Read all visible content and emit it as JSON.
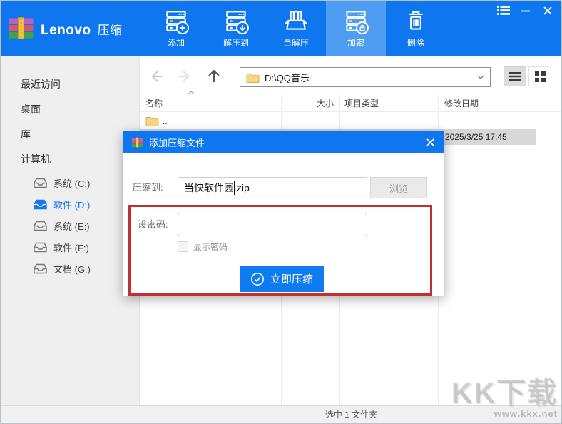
{
  "brand": {
    "name": "Lenovo",
    "app": "压缩"
  },
  "topbar": {
    "toolbar": [
      {
        "label": "添加"
      },
      {
        "label": "解压到"
      },
      {
        "label": "自解压"
      },
      {
        "label": "加密"
      },
      {
        "label": "删除"
      }
    ]
  },
  "sidebar": {
    "items": [
      {
        "label": "最近访问"
      },
      {
        "label": "桌面"
      },
      {
        "label": "库"
      },
      {
        "label": "计算机"
      }
    ],
    "drives": [
      {
        "label": "系统 (C:)"
      },
      {
        "label": "软件 (D:)"
      },
      {
        "label": "系统 (E:)"
      },
      {
        "label": "软件 (F:)"
      },
      {
        "label": "文档 (G:)"
      }
    ]
  },
  "nav": {
    "address": "D:\\QQ音乐"
  },
  "list": {
    "columns": [
      {
        "label": "名称"
      },
      {
        "label": "大小"
      },
      {
        "label": "项目类型"
      },
      {
        "label": "修改日期"
      }
    ],
    "parent_row": "..",
    "selected_row_date": "2025/3/25 17:45"
  },
  "statusbar": {
    "text": "选中 1 文件夹"
  },
  "dialog": {
    "title": "添加压缩文件",
    "compress_to_label": "压缩到:",
    "archive_name": "当快软件园.zip",
    "browse_label": "浏览",
    "password_label": "设密码:",
    "password_value": "",
    "show_password_label": "显示密码",
    "compress_button_label": "立即压缩"
  },
  "watermark": {
    "logo": "KK下载",
    "url": "www.kkx.net"
  },
  "colors": {
    "topbar_blue": "#0E77F0",
    "toolbar_active_blue": "#4F9CF3",
    "highlight_red": "#C22F33",
    "selected_row_gray": "#D8D8D8",
    "selected_drive_blue": "#1578F0"
  }
}
